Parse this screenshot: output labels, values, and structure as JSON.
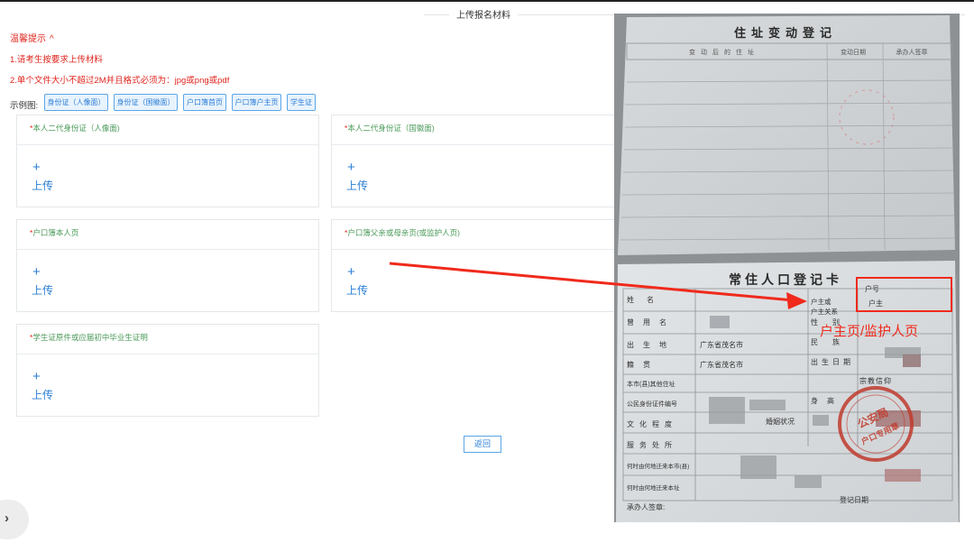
{
  "section_title": "上传报名材料",
  "tips": {
    "header": "温馨提示",
    "lines": [
      "1.请考生按要求上传材料",
      "2.单个文件大小不超过2M并且格式必须为：jpg或png或pdf"
    ]
  },
  "examples": {
    "label": "示例图:",
    "buttons": [
      "身份证（人像面）",
      "身份证（国徽面）",
      "户口簿首页",
      "户口簿户主页",
      "学生证"
    ]
  },
  "upload_cards": [
    {
      "required_mark": "*",
      "title": "本人二代身份证（人像面)",
      "plus": "+",
      "upload_label": "上传"
    },
    {
      "required_mark": "*",
      "title": "本人二代身份证（国徽面)",
      "plus": "+",
      "upload_label": "上传"
    },
    {
      "required_mark": "*",
      "title": "户口簿本人页",
      "plus": "+",
      "upload_label": "上传"
    },
    {
      "required_mark": "*",
      "title": "户口簿父亲或母亲页(或监护人页)",
      "plus": "+",
      "upload_label": "上传"
    },
    {
      "required_mark": "*",
      "title": "学生证原件或应届初中毕业生证明",
      "plus": "+",
      "upload_label": "上传"
    }
  ],
  "back_button": "返回",
  "sidebar_toggle_icon": "chevron-right-icon",
  "colors": {
    "tip_red": "#e0261f",
    "link_blue": "#2a7ed6",
    "label_green": "#4b9a5a",
    "annotation_red": "#f02a1c"
  },
  "photo": {
    "top_title": "住址变动登记",
    "top_headers": [
      "变动后的住址",
      "变动日期",
      "承办人签章"
    ],
    "card_title": "常住人口登记卡",
    "household_label": "户号",
    "relation_label_1": "户主或",
    "relation_label_2": "户主关系",
    "relation_value": "户主",
    "annotation": "户主页/监护人页",
    "left_labels": [
      "姓名",
      "曾用名",
      "出生地",
      "籍贯",
      "本市(县)其他住址",
      "公民身份证件编号",
      "文化程度",
      "服务处所",
      "何时由何地迁来本市(县)",
      "何时由何地迁来本址"
    ],
    "birthplace": "广东省茂名市",
    "native_place": "广东省茂名市",
    "right_labels": [
      "性别",
      "民族",
      "出生日期",
      "宗教信仰",
      "身高",
      "婚姻状况"
    ],
    "footer_left": "承办人签章:",
    "footer_right": "登记日期"
  }
}
